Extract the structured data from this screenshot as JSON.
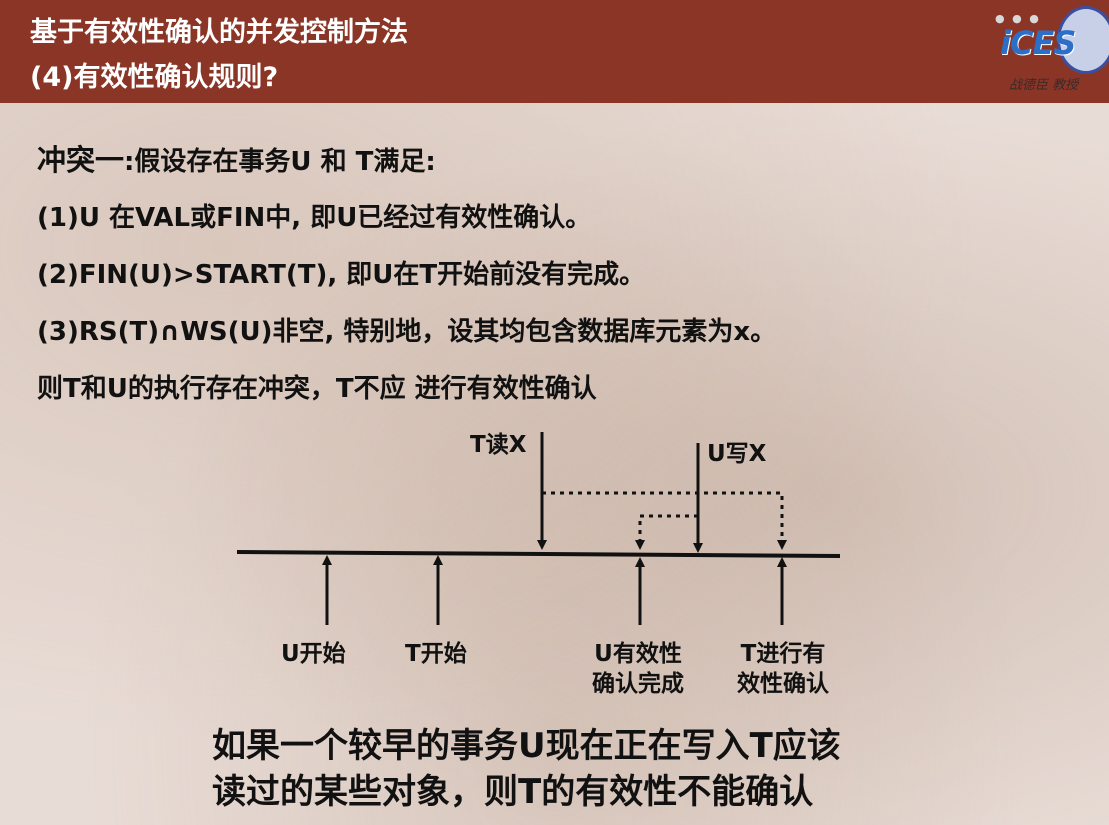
{
  "header": {
    "title": "基于有效性确认的并发控制方法",
    "subtitle": "(4)有效性确认规则?",
    "logo": {
      "text": "iCES",
      "caption": "战德臣 教授",
      "dots": "● ● ●"
    }
  },
  "body": {
    "conflict_heading": "冲突一",
    "conflict_intro": ":假设存在事务U 和 T满足:",
    "conditions": [
      "(1)U 在VAL或FIN中, 即U已经过有效性确认。",
      "(2)FIN(U)>START(T), 即U在T开始前没有完成。",
      "(3)RS(T)∩WS(U)非空, 特别地，设其均包含数据库元素为x。"
    ],
    "conclusion": "则T和U的执行存在冲突，T不应 进行有效性确认"
  },
  "diagram": {
    "t_read_label": "T读X",
    "u_write_label": "U写X",
    "u_start_label": "U开始",
    "t_start_label": "T开始",
    "u_valid_label_1": "U有效性",
    "u_valid_label_2": "确认完成",
    "t_valid_label_1": "T进行有",
    "t_valid_label_2": "效性确认"
  },
  "footer": {
    "line1": "如果一个较早的事务U现在正在写入T应该",
    "line2": "读过的某些对象，则T的有效性不能确认"
  },
  "colors": {
    "header_bg": "#8a3526",
    "text": "#111111"
  }
}
